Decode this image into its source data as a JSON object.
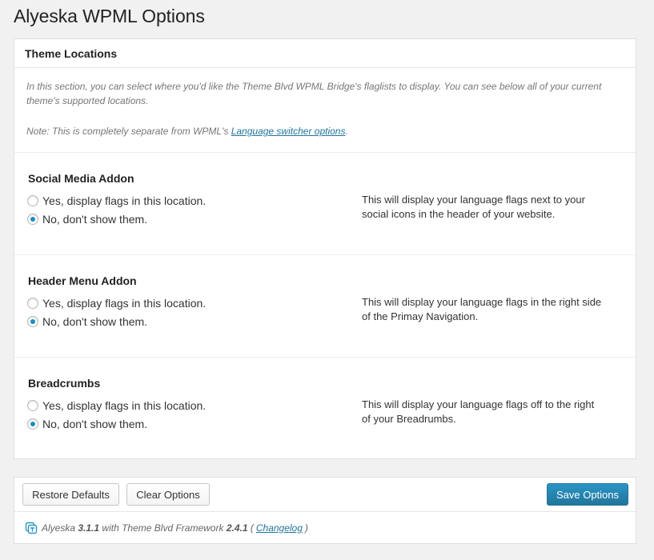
{
  "page": {
    "title": "Alyeska WPML Options"
  },
  "panel": {
    "header": "Theme Locations",
    "intro": "In this section, you can select where you'd like the Theme Blvd WPML Bridge's flaglists to display. You can see below all of your current theme's supported locations.",
    "note_prefix": "Note: This is completely separate from WPML's ",
    "note_link": "Language switcher options",
    "note_suffix": "."
  },
  "sections": [
    {
      "title": "Social Media Addon",
      "yes_label": "Yes, display flags in this location.",
      "no_label": "No, don't show them.",
      "selected": "no",
      "desc": "This will display your language flags next to your social icons in the header of your website."
    },
    {
      "title": "Header Menu Addon",
      "yes_label": "Yes, display flags in this location.",
      "no_label": "No, don't show them.",
      "selected": "no",
      "desc": "This will display your language flags in the right side of the Primay Navigation."
    },
    {
      "title": "Breadcrumbs",
      "yes_label": "Yes, display flags in this location.",
      "no_label": "No, don't show them.",
      "selected": "no",
      "desc": "This will display your language flags off to the right of your Breadrumbs."
    }
  ],
  "footer": {
    "restore_label": "Restore Defaults",
    "clear_label": "Clear Options",
    "save_label": "Save Options",
    "credit_theme": "Alyeska",
    "credit_theme_version": "3.1.1",
    "credit_with": "with Theme Blvd Framework",
    "credit_framework_version": "2.4.1",
    "credit_open": "(",
    "credit_link": "Changelog",
    "credit_close": ")",
    "icon": "theme-blvd-logo-icon"
  },
  "colors": {
    "accent": "#21759b",
    "radio_checked": "#1e8cbe",
    "background": "#f1f1f1"
  }
}
